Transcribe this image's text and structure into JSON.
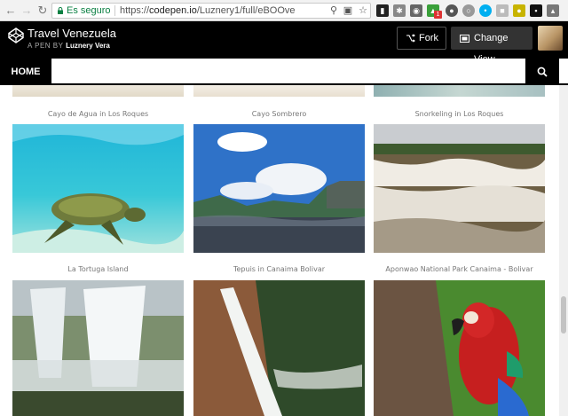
{
  "browser": {
    "secure_label": "Es seguro",
    "url_prefix": "https://",
    "url_domain": "codepen.io",
    "url_path": "/Luznery1/full/eBOOve",
    "extension_badge": "1"
  },
  "header": {
    "title": "Travel Venezuela",
    "subtitle_prefix": "A PEN BY",
    "author": "Luznery Vera",
    "fork_label": "Fork",
    "change_view_label": "Change View"
  },
  "nav": {
    "home_label": "HOME"
  },
  "gallery": {
    "row1_captions": [
      "Cayo de Agua in Los Roques",
      "Cayo Sombrero",
      "Snorkeling in Los Roques"
    ],
    "row2_captions": [
      "La Tortuga Island",
      "Tepuis in Canaima Bolivar",
      "Aponwao National Park Canaima - Bolivar"
    ]
  },
  "colors": {
    "header_bg": "#000000",
    "secure_green": "#0b8043",
    "caption_gray": "#777777"
  }
}
